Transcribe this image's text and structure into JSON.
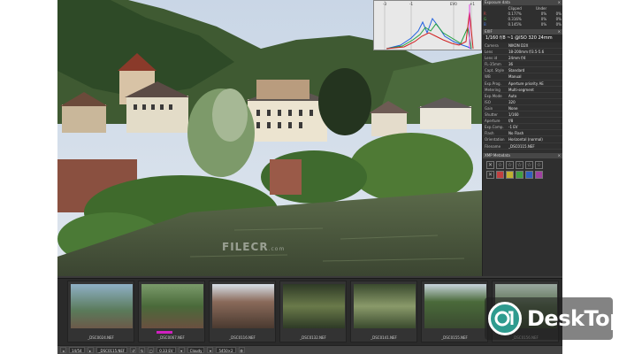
{
  "histogram": {
    "axis_labels": [
      "-3",
      "-1",
      "EV0",
      "+1"
    ]
  },
  "exposure_panel": {
    "title": "Exposure data",
    "columns": [
      "Clipped",
      "Under"
    ],
    "rows": [
      {
        "label": "R",
        "v1": "0.177%",
        "v2": "0%",
        "v3": "0%"
      },
      {
        "label": "G",
        "v1": "0.316%",
        "v2": "0%",
        "v3": "0%"
      },
      {
        "label": "B",
        "v1": "0.145%",
        "v2": "0%",
        "v3": "0%"
      }
    ]
  },
  "exif": {
    "title": "EXIF",
    "summary": "1/160 f/8 ~1 @ISO 320 24mm",
    "rows": [
      {
        "k": "Camera",
        "v": "NIKON D2X"
      },
      {
        "k": "Lens",
        "v": "18-200mm f/3.5-5.6"
      },
      {
        "k": "Lens id",
        "v": "24mm f/4"
      },
      {
        "k": "FL-35mm",
        "v": "36"
      },
      {
        "k": "Capt. Style",
        "v": "Standard"
      },
      {
        "k": "WB",
        "v": "Manual"
      },
      {
        "k": "Exp.Prog.",
        "v": "Aperture priority AE"
      },
      {
        "k": "Metering",
        "v": "Multi-segment"
      },
      {
        "k": "Exp.Mode",
        "v": "Auto"
      },
      {
        "k": "ISO",
        "v": "320"
      },
      {
        "k": "Gain",
        "v": "None"
      },
      {
        "k": "Shutter",
        "v": "1/160"
      },
      {
        "k": "Aperture",
        "v": "f/8"
      },
      {
        "k": "Exp.Comp.",
        "v": "-1 EV"
      },
      {
        "k": "Flash",
        "v": "No Flash"
      },
      {
        "k": "Orientation",
        "v": "Horizontal (normal)"
      },
      {
        "k": "Filename",
        "v": "_DSC0115.NEF"
      }
    ]
  },
  "xmp": {
    "title": "XMP Metadata"
  },
  "filmstrip": [
    {
      "label": "_DSC0024.NEF"
    },
    {
      "label": "_DSC0067.NEF"
    },
    {
      "label": "_DSC0116.NEF"
    },
    {
      "label": "_DSC0132.NEF"
    },
    {
      "label": "_DSC0141.NEF"
    },
    {
      "label": "_DSC0155.NEF"
    },
    {
      "label": "_DSC0156.NEF"
    }
  ],
  "statusbar": {
    "counter": "14/54",
    "filename": "_DSC0115.NEF",
    "zoom": "0.33 EV",
    "mode": "Cloudy",
    "size": "5450×2"
  },
  "watermark": {
    "text": "FILECR",
    "sub": ".com"
  },
  "logo": {
    "text": "DeskTop"
  }
}
